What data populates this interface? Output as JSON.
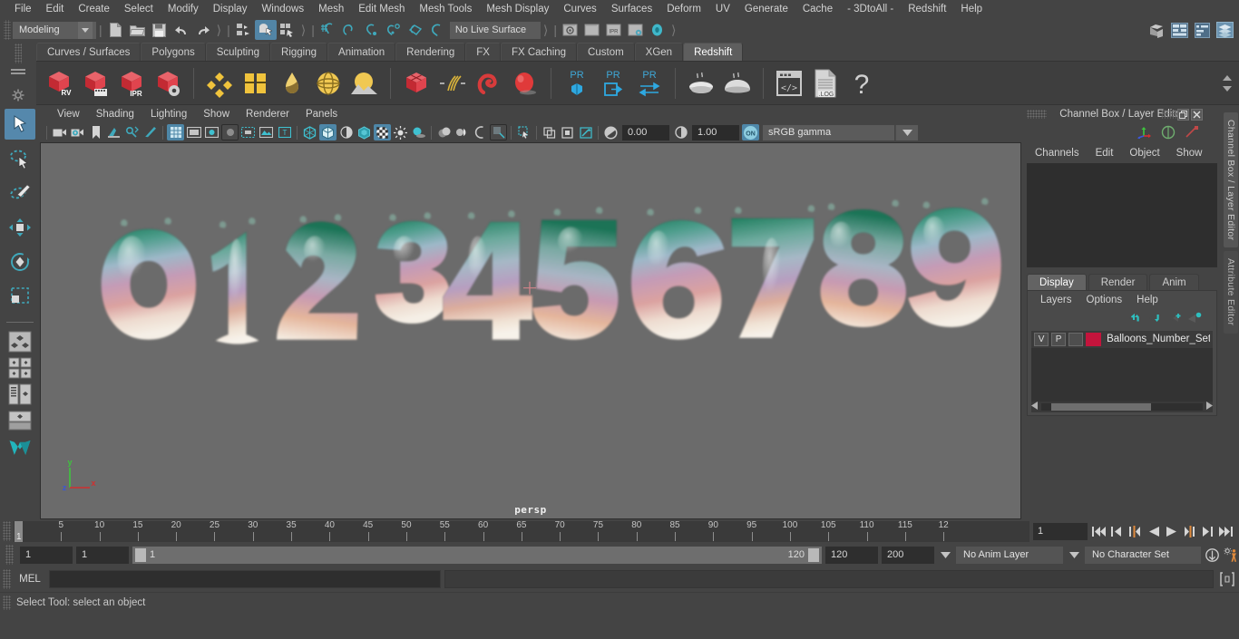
{
  "menubar": {
    "items": [
      "File",
      "Edit",
      "Create",
      "Select",
      "Modify",
      "Display",
      "Windows",
      "Mesh",
      "Edit Mesh",
      "Mesh Tools",
      "Mesh Display",
      "Curves",
      "Surfaces",
      "Deform",
      "UV",
      "Generate",
      "Cache",
      "- 3DtoAll -",
      "Redshift",
      "Help"
    ]
  },
  "statusline": {
    "menu_set": "Modeling",
    "live_surface": "No Live Surface",
    "icons": [
      "new-scene-icon",
      "open-scene-icon",
      "save-scene-icon",
      "undo-icon",
      "redo-icon",
      "select-by-hierarchy-icon",
      "select-by-object-icon",
      "select-by-component-icon",
      "snap-to-grid-icon",
      "snap-to-curve-icon",
      "snap-to-point-icon",
      "snap-to-projected-center-icon",
      "snap-to-view-plane-icon",
      "make-live-icon"
    ],
    "right_toggles": [
      "toggle-modeling-toolkit-icon",
      "toggle-attribute-editor-icon",
      "toggle-tool-settings-icon",
      "toggle-channel-box-icon"
    ]
  },
  "shelf": {
    "tabs": [
      "Curves / Surfaces",
      "Polygons",
      "Sculpting",
      "Rigging",
      "Animation",
      "Rendering",
      "FX",
      "FX Caching",
      "Custom",
      "XGen",
      "Redshift"
    ],
    "active_tab": "Redshift",
    "icons": [
      {
        "name": "redshift-render-view-icon",
        "label": "RV"
      },
      {
        "name": "redshift-render-sequence-icon",
        "label": ""
      },
      {
        "name": "redshift-ipr-icon",
        "label": "IPR"
      },
      {
        "name": "redshift-render-settings-icon",
        "label": ""
      },
      {
        "name": "redshift-material-icon",
        "label": ""
      },
      {
        "name": "redshift-light-blocker-icon",
        "label": ""
      },
      {
        "name": "redshift-bokeh-icon",
        "label": ""
      },
      {
        "name": "redshift-dome-light-icon",
        "label": ""
      },
      {
        "name": "redshift-environment-icon",
        "label": ""
      },
      {
        "name": "redshift-proxy-icon",
        "label": ""
      },
      {
        "name": "redshift-hair-icon",
        "label": ""
      },
      {
        "name": "redshift-volume-icon",
        "label": ""
      },
      {
        "name": "redshift-sprite-icon",
        "label": ""
      },
      {
        "name": "redshift-pr-shader-icon",
        "label": "PR"
      },
      {
        "name": "redshift-pr-export-icon",
        "label": "PR"
      },
      {
        "name": "redshift-pr-transfer-icon",
        "label": "PR"
      },
      {
        "name": "redshift-bake-icon",
        "label": ""
      },
      {
        "name": "redshift-bake-set-icon",
        "label": ""
      },
      {
        "name": "redshift-script-editor-icon",
        "label": ""
      },
      {
        "name": "redshift-log-icon",
        "label": ".LOG"
      },
      {
        "name": "redshift-help-icon",
        "label": "?"
      }
    ]
  },
  "toolbox": {
    "tools": [
      "select-tool-icon",
      "lasso-select-tool-icon",
      "paint-select-tool-icon",
      "move-tool-icon",
      "rotate-tool-icon",
      "scale-tool-icon"
    ],
    "layouts": [
      "single-perspective-layout-icon",
      "four-view-layout-icon",
      "outliner-persp-layout-icon",
      "persp-graph-layout-icon",
      "maya-logo-icon"
    ]
  },
  "viewport": {
    "menus": [
      "View",
      "Shading",
      "Lighting",
      "Show",
      "Renderer",
      "Panels"
    ],
    "camera_label": "persp",
    "exposure": "0.00",
    "gamma": "1.00",
    "color_profile": "sRGB gamma",
    "axis": {
      "x": "x",
      "y": "y",
      "z": "z"
    },
    "colors": {
      "background": "#6b6b6b",
      "x_axis": "#d03030",
      "y_axis": "#3ec43e",
      "z_axis": "#3c56d8"
    },
    "scene_objects": [
      "0",
      "1",
      "2",
      "3",
      "4",
      "5",
      "6",
      "7",
      "8",
      "9"
    ],
    "toolbar_icons": [
      "camera-icon",
      "camera-attributes-icon",
      "bookmark-icon",
      "image-plane-icon",
      "two-d-pan-zoom-icon",
      "grease-pencil-icon",
      "grid-toggle-icon",
      "film-gate-icon",
      "resolution-gate-icon",
      "gate-mask-icon",
      "film-origin-icon",
      "safe-action-icon",
      "titlebar-icon",
      "wireframe-icon",
      "smooth-shade-icon",
      "shaded-wireframe-icon",
      "use-default-material-icon",
      "texture-toggle-icon",
      "lights-toggle-icon",
      "shadows-icon",
      "screen-space-ao-icon",
      "motion-blur-icon",
      "multisample-icon",
      "isolate-select-icon",
      "xray-icon",
      "xray-joints-icon",
      "exposure-icon",
      "gamma-icon",
      "color-management-icon"
    ]
  },
  "channelbox": {
    "title": "Channel Box / Layer Editor",
    "menus": [
      "Channels",
      "Edit",
      "Object",
      "Show"
    ],
    "window_buttons": [
      "restore-window-icon",
      "close-window-icon"
    ],
    "header_icons": [
      "move-axis-icon",
      "rotate-axis-icon",
      "scale-axis-icon"
    ]
  },
  "layereditor": {
    "tabs": [
      "Display",
      "Render",
      "Anim"
    ],
    "active_tab": "Display",
    "menus": [
      "Layers",
      "Options",
      "Help"
    ],
    "buttons": [
      "move-layer-up-icon",
      "move-layer-down-icon",
      "create-new-layer-icon",
      "create-layer-from-selected-icon"
    ],
    "layers": [
      {
        "visibility": "V",
        "playback": "P",
        "shading": "",
        "color": "#c4143c",
        "name": "Balloons_Number_Set_"
      }
    ]
  },
  "right_vtabs": [
    {
      "label": "Channel Box / Layer Editor",
      "active": true
    },
    {
      "label": "Attribute Editor",
      "active": false
    }
  ],
  "timeslider": {
    "start_visible": "1",
    "current_frame": "1",
    "tick_labels": [
      "5",
      "10",
      "15",
      "20",
      "25",
      "30",
      "35",
      "40",
      "45",
      "50",
      "55",
      "60",
      "65",
      "70",
      "75",
      "80",
      "85",
      "90",
      "95",
      "100",
      "105",
      "110",
      "115",
      "12"
    ],
    "playback_buttons": [
      "go-to-start-icon",
      "step-back-keyframe-icon",
      "step-back-frame-icon",
      "play-backwards-icon",
      "play-forwards-icon",
      "step-forward-frame-icon",
      "step-forward-keyframe-icon",
      "go-to-end-icon"
    ]
  },
  "rangeslider": {
    "anim_start": "1",
    "range_start": "1",
    "range_bar_left": "1",
    "range_bar_right": "120",
    "range_end": "120",
    "anim_end": "200",
    "anim_layer": "No Anim Layer",
    "character_set": "No Character Set",
    "icons": [
      "auto-keyframe-icon",
      "animation-preferences-icon"
    ]
  },
  "commandline": {
    "language_label": "MEL",
    "input_value": "",
    "output_value": "",
    "script_editor_icon": "script-editor-icon"
  },
  "helpline": {
    "text": "Select Tool: select an object"
  }
}
